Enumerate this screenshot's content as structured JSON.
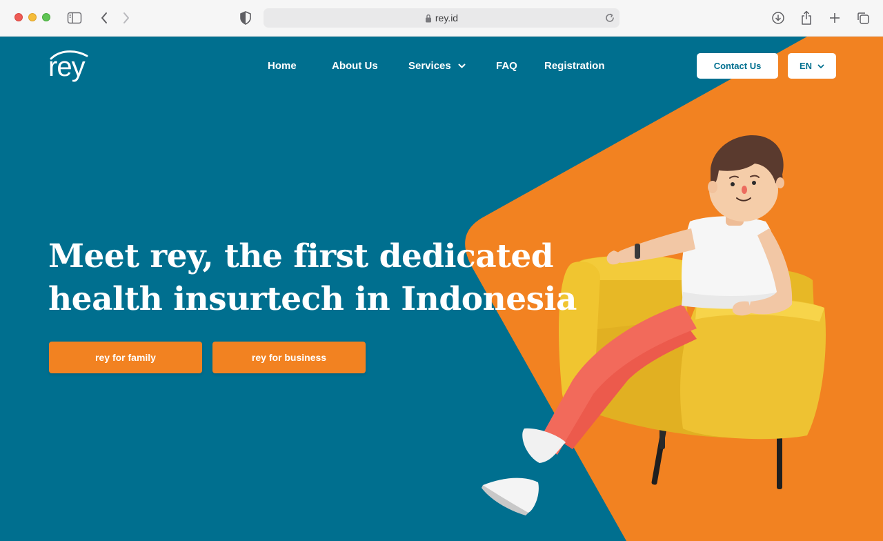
{
  "browser": {
    "url": "rey.id",
    "icons": [
      "sidebar-icon",
      "back-icon",
      "forward-icon",
      "shield-icon",
      "lock-icon",
      "reload-icon",
      "download-icon",
      "share-icon",
      "new-tab-icon",
      "tabs-icon"
    ]
  },
  "header": {
    "logo_text": "rey",
    "nav": [
      {
        "label": "Home"
      },
      {
        "label": "About Us"
      },
      {
        "label": "Services",
        "has_dropdown": true
      },
      {
        "label": "FAQ"
      },
      {
        "label": "Registration"
      }
    ],
    "contact_label": "Contact Us",
    "language": "EN"
  },
  "hero": {
    "title_line1": "Meet rey, the first dedicated",
    "title_line2": "health insurtech in Indonesia",
    "cta_family": "rey for family",
    "cta_business": "rey for business"
  },
  "colors": {
    "primary": "#006f8f",
    "accent": "#f28221",
    "white": "#ffffff"
  }
}
